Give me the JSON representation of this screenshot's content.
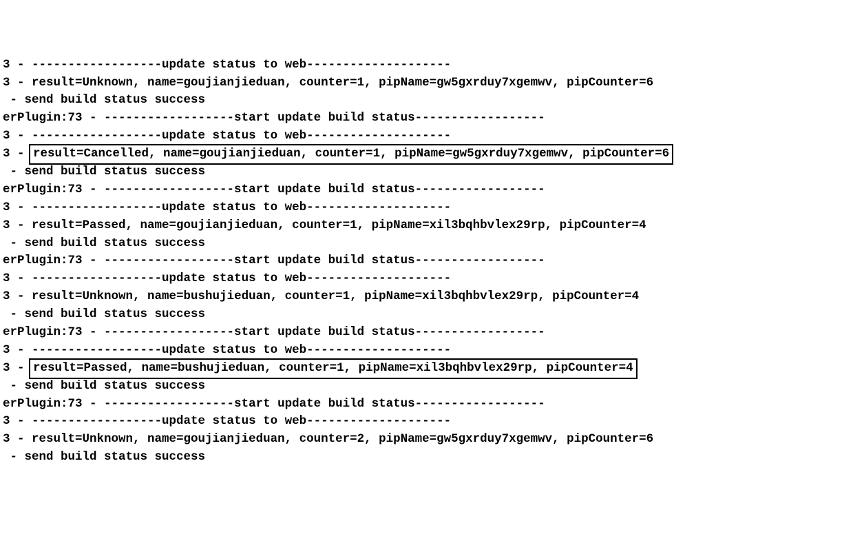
{
  "log": {
    "lines": [
      {
        "prefix": "3 - ",
        "content": "------------------update status to web--------------------",
        "boxed": false
      },
      {
        "prefix": "3 - ",
        "content": "result=Unknown, name=goujianjieduan, counter=1, pipName=gw5gxrduy7xgemwv, pipCounter=6",
        "boxed": false
      },
      {
        "prefix": " - ",
        "content": "send build status success",
        "boxed": false
      },
      {
        "prefix": "erPlugin:73 - ",
        "content": "------------------start update build status------------------",
        "boxed": false
      },
      {
        "prefix": "3 - ",
        "content": "------------------update status to web--------------------",
        "boxed": false
      },
      {
        "prefix": "3 - ",
        "content": "result=Cancelled, name=goujianjieduan, counter=1, pipName=gw5gxrduy7xgemwv, pipCounter=6",
        "boxed": true
      },
      {
        "prefix": " - ",
        "content": "send build status success",
        "boxed": false
      },
      {
        "prefix": "erPlugin:73 - ",
        "content": "------------------start update build status------------------",
        "boxed": false
      },
      {
        "prefix": "3 - ",
        "content": "------------------update status to web--------------------",
        "boxed": false
      },
      {
        "prefix": "3 - ",
        "content": "result=Passed, name=goujianjieduan, counter=1, pipName=xil3bqhbvlex29rp, pipCounter=4",
        "boxed": false
      },
      {
        "prefix": " - ",
        "content": "send build status success",
        "boxed": false
      },
      {
        "prefix": "erPlugin:73 - ",
        "content": "------------------start update build status------------------",
        "boxed": false
      },
      {
        "prefix": "3 - ",
        "content": "------------------update status to web--------------------",
        "boxed": false
      },
      {
        "prefix": "3 - ",
        "content": "result=Unknown, name=bushujieduan, counter=1, pipName=xil3bqhbvlex29rp, pipCounter=4",
        "boxed": false
      },
      {
        "prefix": " - ",
        "content": "send build status success",
        "boxed": false
      },
      {
        "prefix": "erPlugin:73 - ",
        "content": "------------------start update build status------------------",
        "boxed": false
      },
      {
        "prefix": "3 - ",
        "content": "------------------update status to web--------------------",
        "boxed": false
      },
      {
        "prefix": "3 - ",
        "content": "result=Passed, name=bushujieduan, counter=1, pipName=xil3bqhbvlex29rp, pipCounter=4",
        "boxed": true
      },
      {
        "prefix": " - ",
        "content": "send build status success",
        "boxed": false
      },
      {
        "prefix": "erPlugin:73 - ",
        "content": "------------------start update build status------------------",
        "boxed": false
      },
      {
        "prefix": "3 - ",
        "content": "------------------update status to web--------------------",
        "boxed": false
      },
      {
        "prefix": "3 - ",
        "content": "result=Unknown, name=goujianjieduan, counter=2, pipName=gw5gxrduy7xgemwv, pipCounter=6",
        "boxed": false
      },
      {
        "prefix": " - ",
        "content": "send build status success",
        "boxed": false
      }
    ]
  }
}
